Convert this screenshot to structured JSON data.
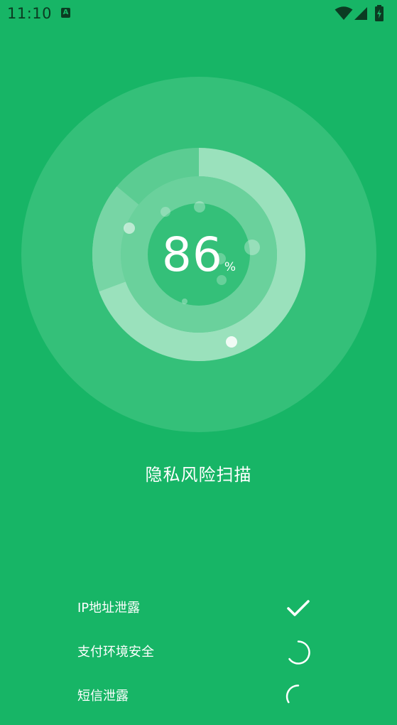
{
  "status_bar": {
    "time": "11:10",
    "notification_icon": "A",
    "icons": [
      "wifi-icon",
      "cell-signal-icon",
      "battery-charging-icon"
    ]
  },
  "scan": {
    "progress_percent": 86,
    "progress_value": "86",
    "unit": "%",
    "title": "隐私风险扫描",
    "items": [
      {
        "label": "IP地址泄露",
        "state": "done",
        "icon": "check-icon"
      },
      {
        "label": "支付环境安全",
        "state": "scanning",
        "icon": "loading-spinner-icon"
      },
      {
        "label": "短信泄露",
        "state": "scanning",
        "icon": "loading-spinner-icon"
      }
    ]
  },
  "colors": {
    "background": "#17b566",
    "ring_outer": "#34c079",
    "progress_arc": "#9ae1bc",
    "text": "#ffffff",
    "status_text": "#0b3b22"
  }
}
